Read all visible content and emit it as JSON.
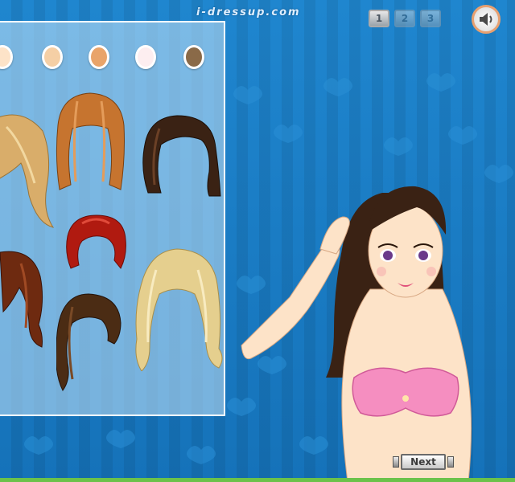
{
  "site": {
    "brand": "i-dressup.com"
  },
  "steps": [
    {
      "label": "1",
      "active": true
    },
    {
      "label": "2",
      "active": false
    },
    {
      "label": "3",
      "active": false
    }
  ],
  "sound": {
    "icon": "speaker-icon"
  },
  "colors": {
    "background": "#1a7bc4",
    "swatches": [
      "#fde3c8",
      "#f5cfa5",
      "#e9a46a",
      "#fdeef0",
      "#8a6a48"
    ],
    "hair_styles": [
      "#d9ad6a",
      "#c6742f",
      "#3a2214",
      "#b01a10",
      "#6e2a10",
      "#4b2c14",
      "#e5cf8e"
    ]
  },
  "navigation": {
    "next_label": "Next"
  }
}
